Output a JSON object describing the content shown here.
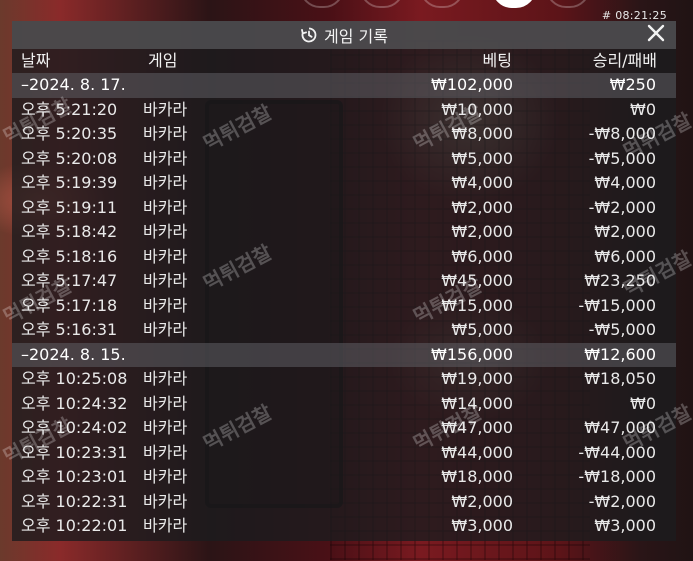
{
  "clock": "# 08:21:25",
  "panel": {
    "title": "게임 기록",
    "close_glyph": "✕"
  },
  "columns": {
    "date": "날짜",
    "game": "게임",
    "bet": "베팅",
    "result": "승리/패배"
  },
  "watermark": "먹튀검찰",
  "rows": [
    {
      "type": "day",
      "date": "–2024. 8. 17.",
      "game": "",
      "bet": "₩102,000",
      "result": "₩250"
    },
    {
      "type": "entry",
      "date": "오후 5:21:20",
      "game": "바카라",
      "bet": "₩10,000",
      "result": "₩0"
    },
    {
      "type": "entry",
      "date": "오후 5:20:35",
      "game": "바카라",
      "bet": "₩8,000",
      "result": "-₩8,000"
    },
    {
      "type": "entry",
      "date": "오후 5:20:08",
      "game": "바카라",
      "bet": "₩5,000",
      "result": "-₩5,000"
    },
    {
      "type": "entry",
      "date": "오후 5:19:39",
      "game": "바카라",
      "bet": "₩4,000",
      "result": "₩4,000"
    },
    {
      "type": "entry",
      "date": "오후 5:19:11",
      "game": "바카라",
      "bet": "₩2,000",
      "result": "-₩2,000"
    },
    {
      "type": "entry",
      "date": "오후 5:18:42",
      "game": "바카라",
      "bet": "₩2,000",
      "result": "₩2,000"
    },
    {
      "type": "entry",
      "date": "오후 5:18:16",
      "game": "바카라",
      "bet": "₩6,000",
      "result": "₩6,000"
    },
    {
      "type": "entry",
      "date": "오후 5:17:47",
      "game": "바카라",
      "bet": "₩45,000",
      "result": "₩23,250"
    },
    {
      "type": "entry",
      "date": "오후 5:17:18",
      "game": "바카라",
      "bet": "₩15,000",
      "result": "-₩15,000"
    },
    {
      "type": "entry",
      "date": "오후 5:16:31",
      "game": "바카라",
      "bet": "₩5,000",
      "result": "-₩5,000"
    },
    {
      "type": "day",
      "date": "–2024. 8. 15.",
      "game": "",
      "bet": "₩156,000",
      "result": "₩12,600"
    },
    {
      "type": "entry",
      "date": "오후 10:25:08",
      "game": "바카라",
      "bet": "₩19,000",
      "result": "₩18,050"
    },
    {
      "type": "entry",
      "date": "오후 10:24:32",
      "game": "바카라",
      "bet": "₩14,000",
      "result": "₩0"
    },
    {
      "type": "entry",
      "date": "오후 10:24:02",
      "game": "바카라",
      "bet": "₩47,000",
      "result": "₩47,000"
    },
    {
      "type": "entry",
      "date": "오후 10:23:31",
      "game": "바카라",
      "bet": "₩44,000",
      "result": "-₩44,000"
    },
    {
      "type": "entry",
      "date": "오후 10:23:01",
      "game": "바카라",
      "bet": "₩18,000",
      "result": "-₩18,000"
    },
    {
      "type": "entry",
      "date": "오후 10:22:31",
      "game": "바카라",
      "bet": "₩2,000",
      "result": "-₩2,000"
    },
    {
      "type": "entry",
      "date": "오후 10:22:01",
      "game": "바카라",
      "bet": "₩3,000",
      "result": "₩3,000"
    }
  ],
  "colors": {
    "day_row_bg": "#5f5f64",
    "header_bg": "#505052",
    "text": "#e9e9e9"
  },
  "icons": {
    "history": "history-icon",
    "close": "close-icon"
  }
}
